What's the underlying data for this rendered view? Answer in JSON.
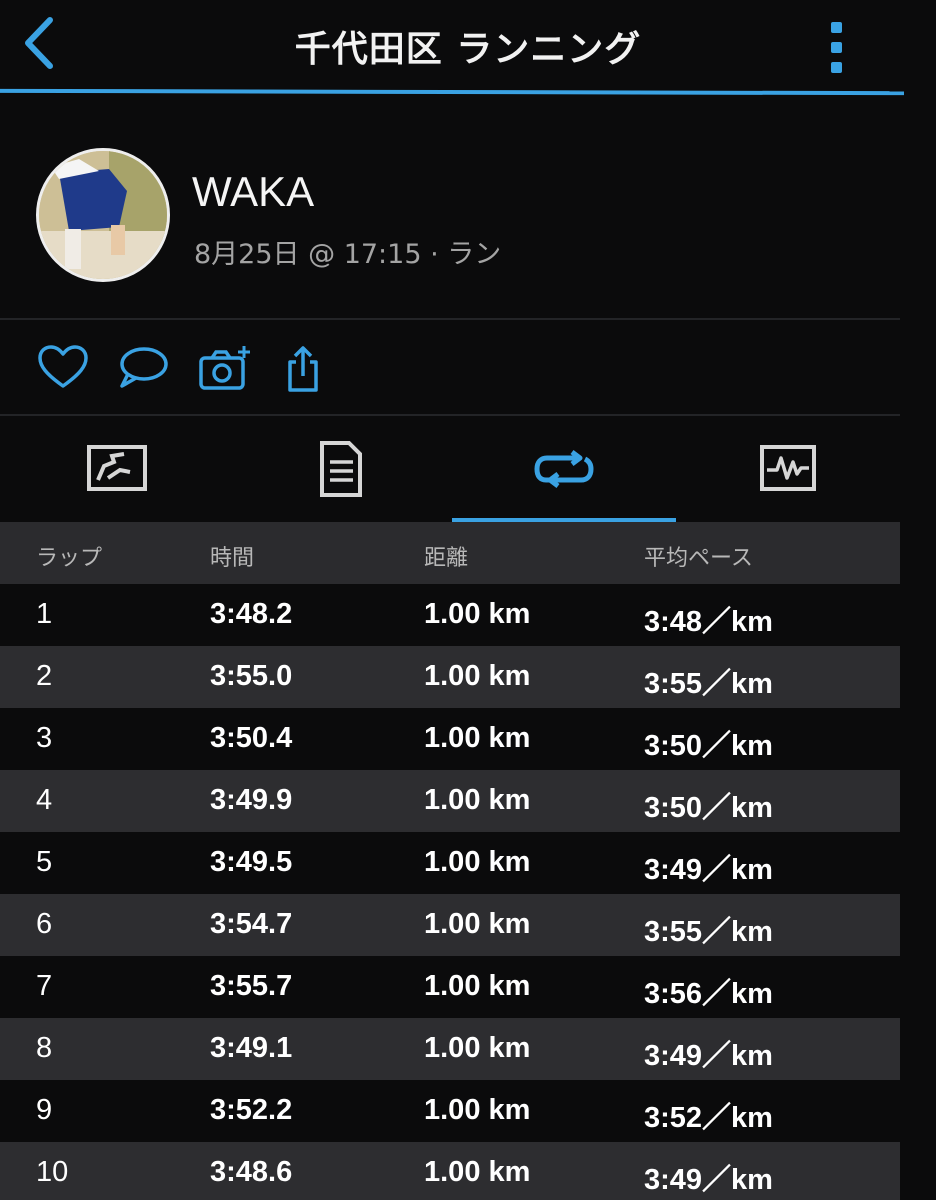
{
  "header": {
    "title": "千代田区 ランニング",
    "back_icon": "chevron-left-icon",
    "more_icon": "more-vertical-icon",
    "accent": "#3aa2e3"
  },
  "profile": {
    "name": "WAKA",
    "meta": "8月25日 @ 17:15 · ラン"
  },
  "actions": [
    "heart-icon",
    "comment-icon",
    "add-photo-icon",
    "share-icon"
  ],
  "tabs": [
    {
      "icon": "map-icon",
      "selected": false
    },
    {
      "icon": "details-icon",
      "selected": false
    },
    {
      "icon": "laps-icon",
      "selected": true
    },
    {
      "icon": "chart-icon",
      "selected": false
    }
  ],
  "table": {
    "headers": [
      "ラップ",
      "時間",
      "距離",
      "平均ペース"
    ],
    "rows": [
      [
        "1",
        "3:48.2",
        "1.00 km",
        "3:48／km"
      ],
      [
        "2",
        "3:55.0",
        "1.00 km",
        "3:55／km"
      ],
      [
        "3",
        "3:50.4",
        "1.00 km",
        "3:50／km"
      ],
      [
        "4",
        "3:49.9",
        "1.00 km",
        "3:50／km"
      ],
      [
        "5",
        "3:49.5",
        "1.00 km",
        "3:49／km"
      ],
      [
        "6",
        "3:54.7",
        "1.00 km",
        "3:55／km"
      ],
      [
        "7",
        "3:55.7",
        "1.00 km",
        "3:56／km"
      ],
      [
        "8",
        "3:49.1",
        "1.00 km",
        "3:49／km"
      ],
      [
        "9",
        "3:52.2",
        "1.00 km",
        "3:52／km"
      ],
      [
        "10",
        "3:48.6",
        "1.00 km",
        "3:49／km"
      ]
    ]
  }
}
